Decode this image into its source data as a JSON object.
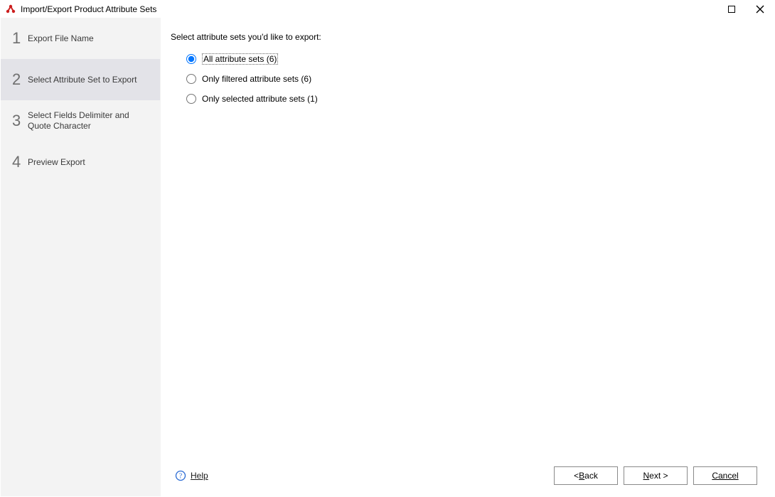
{
  "window": {
    "title": "Import/Export Product Attribute Sets"
  },
  "sidebar": {
    "steps": [
      {
        "num": "1",
        "label": "Export File Name"
      },
      {
        "num": "2",
        "label": "Select Attribute Set to Export"
      },
      {
        "num": "3",
        "label": "Select Fields Delimiter and Quote Character"
      },
      {
        "num": "4",
        "label": "Preview Export"
      }
    ]
  },
  "content": {
    "prompt": "Select attribute sets you'd like to export:",
    "options": [
      {
        "label": "All attribute sets (6)",
        "selected": true
      },
      {
        "label": "Only filtered attribute sets (6)",
        "selected": false
      },
      {
        "label": "Only selected attribute sets (1)",
        "selected": false
      }
    ]
  },
  "footer": {
    "help": "Help",
    "back_prefix": "< ",
    "back_mnemonic": "B",
    "back_rest": "ack",
    "next_mnemonic": "N",
    "next_rest": "ext >",
    "cancel": "Cancel"
  }
}
